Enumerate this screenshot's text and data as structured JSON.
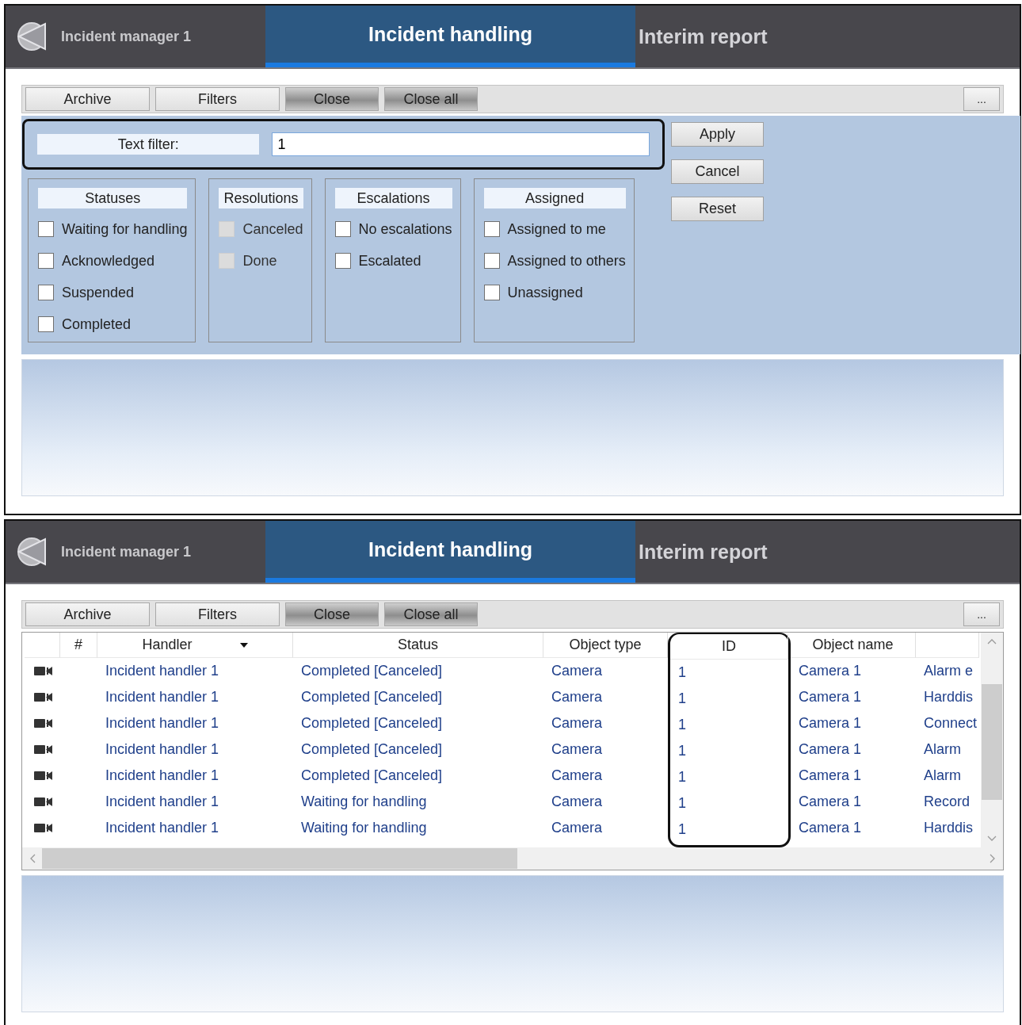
{
  "panels": [
    {
      "kind": "filters",
      "header": {
        "app_title": "Incident manager 1",
        "tabs": [
          {
            "label": "Incident handling",
            "selected": true
          },
          {
            "label": "Interim report",
            "selected": false
          }
        ]
      },
      "toolbar": {
        "buttons": [
          {
            "label": "Archive",
            "kind": "light"
          },
          {
            "label": "Filters",
            "kind": "light"
          },
          {
            "label": "Close",
            "kind": "dark"
          },
          {
            "label": "Close all",
            "kind": "dark"
          }
        ],
        "more_button": "..."
      },
      "text_filter": {
        "label": "Text filter:",
        "value": "1",
        "highlighted": true
      },
      "actions": [
        "Apply",
        "Cancel",
        "Reset"
      ],
      "groups": [
        {
          "title": "Statuses",
          "options": [
            {
              "label": "Waiting for handling",
              "checked": false,
              "disabled": false
            },
            {
              "label": "Acknowledged",
              "checked": false,
              "disabled": false
            },
            {
              "label": "Suspended",
              "checked": false,
              "disabled": false
            },
            {
              "label": "Completed",
              "checked": false,
              "disabled": false
            }
          ]
        },
        {
          "title": "Resolutions",
          "options": [
            {
              "label": "Canceled",
              "checked": false,
              "disabled": true
            },
            {
              "label": "Done",
              "checked": false,
              "disabled": true
            }
          ]
        },
        {
          "title": "Escalations",
          "options": [
            {
              "label": "No escalations",
              "checked": false,
              "disabled": false
            },
            {
              "label": "Escalated",
              "checked": false,
              "disabled": false
            }
          ]
        },
        {
          "title": "Assigned",
          "options": [
            {
              "label": "Assigned to me",
              "checked": false,
              "disabled": false
            },
            {
              "label": "Assigned to others",
              "checked": false,
              "disabled": false
            },
            {
              "label": "Unassigned",
              "checked": false,
              "disabled": false
            }
          ]
        }
      ]
    },
    {
      "kind": "table",
      "header": {
        "app_title": "Incident manager 1",
        "tabs": [
          {
            "label": "Incident handling",
            "selected": true
          },
          {
            "label": "Interim report",
            "selected": false
          }
        ]
      },
      "toolbar": {
        "buttons": [
          {
            "label": "Archive",
            "kind": "light"
          },
          {
            "label": "Filters",
            "kind": "light"
          },
          {
            "label": "Close",
            "kind": "dark"
          },
          {
            "label": "Close all",
            "kind": "dark"
          }
        ],
        "more_button": "..."
      },
      "table": {
        "columns": [
          {
            "label": "#",
            "filter_menu": false,
            "highlighted": false
          },
          {
            "label": "Handler",
            "filter_menu": true,
            "highlighted": false
          },
          {
            "label": "Status",
            "filter_menu": false,
            "highlighted": false
          },
          {
            "label": "Object type",
            "filter_menu": false,
            "highlighted": false
          },
          {
            "label": "ID",
            "filter_menu": false,
            "highlighted": true
          },
          {
            "label": "Object name",
            "filter_menu": false,
            "highlighted": false
          },
          {
            "filter_menu": false,
            "highlighted": false
          }
        ],
        "rows": [
          {
            "cells": [
              "",
              "Incident handler 1",
              "Completed [Canceled]",
              "Camera",
              "1",
              "Camera 1",
              "Alarm e"
            ]
          },
          {
            "cells": [
              "",
              "Incident handler 1",
              "Completed [Canceled]",
              "Camera",
              "1",
              "Camera 1",
              "Harddis"
            ]
          },
          {
            "cells": [
              "",
              "Incident handler 1",
              "Completed [Canceled]",
              "Camera",
              "1",
              "Camera 1",
              "Connect"
            ]
          },
          {
            "cells": [
              "",
              "Incident handler 1",
              "Completed [Canceled]",
              "Camera",
              "1",
              "Camera 1",
              "Alarm"
            ]
          },
          {
            "cells": [
              "",
              "Incident handler 1",
              "Completed [Canceled]",
              "Camera",
              "1",
              "Camera 1",
              "Alarm"
            ]
          },
          {
            "cells": [
              "",
              "Incident handler 1",
              "Waiting for handling",
              "Camera",
              "1",
              "Camera 1",
              "Record"
            ]
          },
          {
            "cells": [
              "",
              "Incident handler 1",
              "Waiting for handling",
              "Camera",
              "1",
              "Camera 1",
              "Harddis"
            ]
          }
        ]
      }
    }
  ]
}
